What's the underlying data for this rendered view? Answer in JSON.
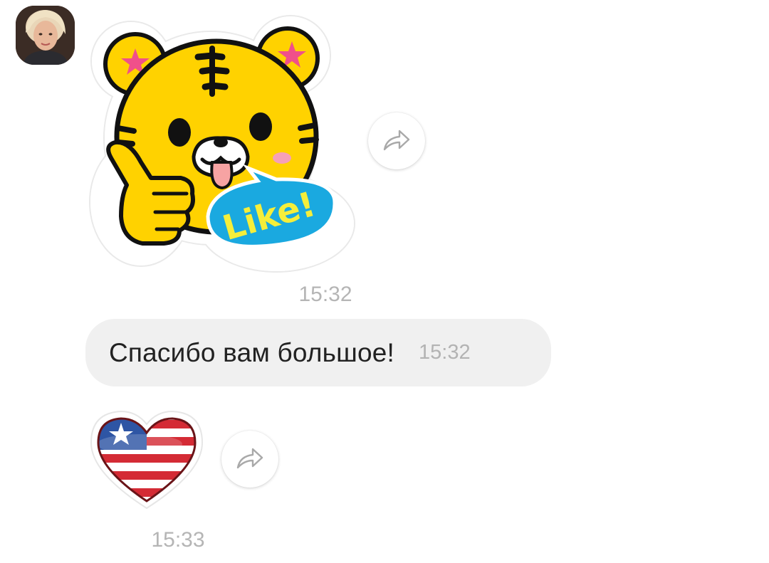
{
  "messages": [
    {
      "kind": "sticker",
      "sticker_name": "tiger-like-sticker",
      "sticker_text": "Like!",
      "time": "15:32"
    },
    {
      "kind": "text",
      "text": "Спасибо вам большое!",
      "time": "15:32"
    },
    {
      "kind": "sticker",
      "sticker_name": "us-flag-heart-sticker",
      "time": "15:33"
    }
  ],
  "icons": {
    "share": "share-arrow-icon",
    "avatar": "contact-avatar"
  },
  "colors": {
    "bubble_bg": "#f0f0f0",
    "timestamp": "#b5b5b5",
    "tiger_yellow": "#ffd200",
    "like_blue": "#1aa9e0",
    "like_text": "#f5ee3a"
  }
}
